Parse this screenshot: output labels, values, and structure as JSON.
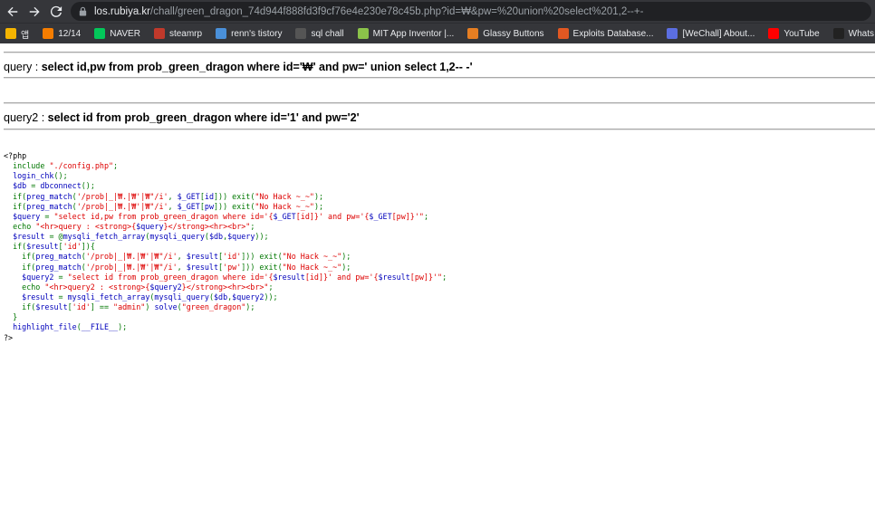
{
  "browser": {
    "url_host": "los.rubiya.kr",
    "url_rest": "/chall/green_dragon_74d944f888fd3f9cf76e4e230e78c45b.php?id=₩&pw=%20union%20select%201,2--+-",
    "bookmarks": [
      {
        "label": "앱",
        "icon": "apps-grid-icon",
        "color": "#f4b400"
      },
      {
        "label": "12/14",
        "icon": "blogger-icon",
        "color": "#f57d00"
      },
      {
        "label": "NAVER",
        "icon": "naver-icon",
        "color": "#03c75a"
      },
      {
        "label": "steamrp",
        "icon": "steamrp-icon",
        "color": "#c0392b"
      },
      {
        "label": "renn's tistory",
        "icon": "tistory-icon",
        "color": "#4a90d9"
      },
      {
        "label": "sql chall",
        "icon": "z-icon",
        "color": "#555555"
      },
      {
        "label": "MIT App Inventor |...",
        "icon": "app-inventor-icon",
        "color": "#8bc34a"
      },
      {
        "label": "Glassy Buttons",
        "icon": "glassy-icon",
        "color": "#e67e22"
      },
      {
        "label": "Exploits Database...",
        "icon": "exploit-db-icon",
        "color": "#e25822"
      },
      {
        "label": "[WeChall] About...",
        "icon": "wechall-icon",
        "color": "#5b6ee1"
      },
      {
        "label": "YouTube",
        "icon": "youtube-icon",
        "color": "#ff0000"
      },
      {
        "label": "Whats My IP Addr...",
        "icon": "whatsmyip-icon",
        "color": "#222222"
      }
    ]
  },
  "query1": {
    "label": "query : ",
    "value": "select id,pw from prob_green_dragon where id='₩' and pw=' union select 1,2-- -'"
  },
  "query2": {
    "label": "query2 : ",
    "value": "select id from prob_green_dragon where id='1' and pw='2'"
  },
  "source_code": [
    [
      [
        "plain",
        "<?php"
      ]
    ],
    [
      [
        "plain",
        "  "
      ],
      [
        "kw",
        "include "
      ],
      [
        "str",
        "\"./config.php\""
      ],
      [
        "kw",
        ";"
      ]
    ],
    [
      [
        "plain",
        "  "
      ],
      [
        "var",
        "login_chk"
      ],
      [
        "kw",
        "();"
      ]
    ],
    [
      [
        "plain",
        "  "
      ],
      [
        "var",
        "$db "
      ],
      [
        "kw",
        "= "
      ],
      [
        "var",
        "dbconnect"
      ],
      [
        "kw",
        "();"
      ]
    ],
    [
      [
        "plain",
        "  "
      ],
      [
        "kw",
        "if("
      ],
      [
        "var",
        "preg_match"
      ],
      [
        "kw",
        "("
      ],
      [
        "str",
        "'/prob|_|₩.|₩'|₩\"/i'"
      ],
      [
        "kw",
        ", "
      ],
      [
        "var",
        "$_GET"
      ],
      [
        "kw",
        "["
      ],
      [
        "var",
        "id"
      ],
      [
        "kw",
        "])) exit("
      ],
      [
        "str",
        "\"No Hack ~_~\""
      ],
      [
        "kw",
        ");"
      ]
    ],
    [
      [
        "plain",
        "  "
      ],
      [
        "kw",
        "if("
      ],
      [
        "var",
        "preg_match"
      ],
      [
        "kw",
        "("
      ],
      [
        "str",
        "'/prob|_|₩.|₩'|₩\"/i'"
      ],
      [
        "kw",
        ", "
      ],
      [
        "var",
        "$_GET"
      ],
      [
        "kw",
        "["
      ],
      [
        "var",
        "pw"
      ],
      [
        "kw",
        "])) exit("
      ],
      [
        "str",
        "\"No Hack ~_~\""
      ],
      [
        "kw",
        ");"
      ]
    ],
    [
      [
        "plain",
        "  "
      ],
      [
        "var",
        "$query "
      ],
      [
        "kw",
        "= "
      ],
      [
        "str",
        "\"select id,pw from prob_green_dragon where id='{"
      ],
      [
        "var",
        "$_GET"
      ],
      [
        "str",
        "[id]}' and pw='{"
      ],
      [
        "var",
        "$_GET"
      ],
      [
        "str",
        "[pw]}'\""
      ],
      [
        "kw",
        ";"
      ]
    ],
    [
      [
        "plain",
        "  "
      ],
      [
        "kw",
        "echo "
      ],
      [
        "str",
        "\"<hr>query : <strong>{"
      ],
      [
        "var",
        "$query"
      ],
      [
        "str",
        "}</strong><hr><br>\""
      ],
      [
        "kw",
        ";"
      ]
    ],
    [
      [
        "plain",
        "  "
      ],
      [
        "var",
        "$result "
      ],
      [
        "kw",
        "= @"
      ],
      [
        "var",
        "mysqli_fetch_array"
      ],
      [
        "kw",
        "("
      ],
      [
        "var",
        "mysqli_query"
      ],
      [
        "kw",
        "("
      ],
      [
        "var",
        "$db"
      ],
      [
        "kw",
        ","
      ],
      [
        "var",
        "$query"
      ],
      [
        "kw",
        "));"
      ]
    ],
    [
      [
        "plain",
        "  "
      ],
      [
        "kw",
        "if("
      ],
      [
        "var",
        "$result"
      ],
      [
        "kw",
        "["
      ],
      [
        "str",
        "'id'"
      ],
      [
        "kw",
        "]){"
      ]
    ],
    [
      [
        "plain",
        "    "
      ],
      [
        "kw",
        "if("
      ],
      [
        "var",
        "preg_match"
      ],
      [
        "kw",
        "("
      ],
      [
        "str",
        "'/prob|_|₩.|₩'|₩\"/i'"
      ],
      [
        "kw",
        ", "
      ],
      [
        "var",
        "$result"
      ],
      [
        "kw",
        "["
      ],
      [
        "str",
        "'id'"
      ],
      [
        "kw",
        "])) exit("
      ],
      [
        "str",
        "\"No Hack ~_~\""
      ],
      [
        "kw",
        ");"
      ]
    ],
    [
      [
        "plain",
        "    "
      ],
      [
        "kw",
        "if("
      ],
      [
        "var",
        "preg_match"
      ],
      [
        "kw",
        "("
      ],
      [
        "str",
        "'/prob|_|₩.|₩'|₩\"/i'"
      ],
      [
        "kw",
        ", "
      ],
      [
        "var",
        "$result"
      ],
      [
        "kw",
        "["
      ],
      [
        "str",
        "'pw'"
      ],
      [
        "kw",
        "])) exit("
      ],
      [
        "str",
        "\"No Hack ~_~\""
      ],
      [
        "kw",
        ");"
      ]
    ],
    [
      [
        "plain",
        "    "
      ],
      [
        "var",
        "$query2 "
      ],
      [
        "kw",
        "= "
      ],
      [
        "str",
        "\"select id from prob_green_dragon where id='{"
      ],
      [
        "var",
        "$result"
      ],
      [
        "str",
        "[id]}' and pw='{"
      ],
      [
        "var",
        "$result"
      ],
      [
        "str",
        "[pw]}'\""
      ],
      [
        "kw",
        ";"
      ]
    ],
    [
      [
        "plain",
        "    "
      ],
      [
        "kw",
        "echo "
      ],
      [
        "str",
        "\"<hr>query2 : <strong>{"
      ],
      [
        "var",
        "$query2"
      ],
      [
        "str",
        "}</strong><hr><br>\""
      ],
      [
        "kw",
        ";"
      ]
    ],
    [
      [
        "plain",
        "    "
      ],
      [
        "var",
        "$result "
      ],
      [
        "kw",
        "= "
      ],
      [
        "var",
        "mysqli_fetch_array"
      ],
      [
        "kw",
        "("
      ],
      [
        "var",
        "mysqli_query"
      ],
      [
        "kw",
        "("
      ],
      [
        "var",
        "$db"
      ],
      [
        "kw",
        ","
      ],
      [
        "var",
        "$query2"
      ],
      [
        "kw",
        "));"
      ]
    ],
    [
      [
        "plain",
        "    "
      ],
      [
        "kw",
        "if("
      ],
      [
        "var",
        "$result"
      ],
      [
        "kw",
        "["
      ],
      [
        "str",
        "'id'"
      ],
      [
        "kw",
        "] == "
      ],
      [
        "str",
        "\"admin\""
      ],
      [
        "kw",
        ") "
      ],
      [
        "var",
        "solve"
      ],
      [
        "kw",
        "("
      ],
      [
        "str",
        "\"green_dragon\""
      ],
      [
        "kw",
        ");"
      ]
    ],
    [
      [
        "plain",
        "  "
      ],
      [
        "kw",
        "}"
      ]
    ],
    [
      [
        "plain",
        "  "
      ],
      [
        "var",
        "highlight_file"
      ],
      [
        "kw",
        "("
      ],
      [
        "var",
        "__FILE__"
      ],
      [
        "kw",
        ");"
      ]
    ],
    [
      [
        "plain",
        "?>"
      ]
    ]
  ]
}
